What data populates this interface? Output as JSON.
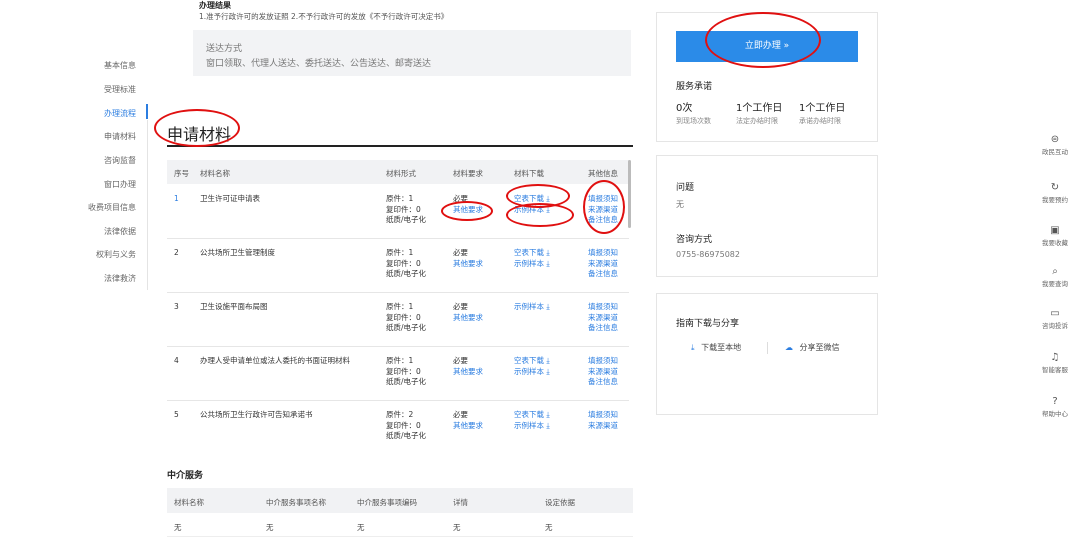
{
  "result": {
    "title": "办理结果",
    "text": "1.准予行政许可的发放证照 2.不予行政许可的发放《不予行政许可决定书》"
  },
  "delivery": {
    "title": "送达方式",
    "text": "窗口领取、代理人送达、委托送达、公告送达、邮寄送达"
  },
  "sidebar": {
    "items": [
      {
        "label": "基本信息"
      },
      {
        "label": "受理标准"
      },
      {
        "label": "办理流程"
      },
      {
        "label": "申请材料"
      },
      {
        "label": "咨询监督"
      },
      {
        "label": "窗口办理"
      },
      {
        "label": "收费项目信息"
      },
      {
        "label": "法律依据"
      },
      {
        "label": "权利与义务"
      },
      {
        "label": "法律救济"
      }
    ],
    "active_index": 2
  },
  "materials": {
    "section_title": "申请材料",
    "headers": [
      "序号",
      "材料名称",
      "材料形式",
      "材料要求",
      "材料下载",
      "其他信息"
    ],
    "rows": [
      {
        "no": "1",
        "name": "卫生许可证申请表",
        "forms": [
          "原件：1",
          "复印件：0",
          "纸质/电子化"
        ],
        "req": [
          "必要",
          "其他要求"
        ],
        "dl": [
          "空表下载",
          "示例样本"
        ],
        "other": [
          "填报须知",
          "来源渠道",
          "备注信息"
        ]
      },
      {
        "no": "2",
        "name": "公共场所卫生管理制度",
        "forms": [
          "原件：1",
          "复印件：0",
          "纸质/电子化"
        ],
        "req": [
          "必要",
          "其他要求"
        ],
        "dl": [
          "空表下载",
          "示例样本"
        ],
        "other": [
          "填报须知",
          "来源渠道",
          "备注信息"
        ]
      },
      {
        "no": "3",
        "name": "卫生设施平面布局图",
        "forms": [
          "原件：1",
          "复印件：0",
          "纸质/电子化"
        ],
        "req": [
          "必要",
          "其他要求"
        ],
        "dl": [
          "示例样本"
        ],
        "other": [
          "填报须知",
          "来源渠道",
          "备注信息"
        ]
      },
      {
        "no": "4",
        "name": "办理人受申请单位或法人委托的书面证明材料",
        "forms": [
          "原件：1",
          "复印件：0",
          "纸质/电子化"
        ],
        "req": [
          "必要",
          "其他要求"
        ],
        "dl": [
          "空表下载",
          "示例样本"
        ],
        "other": [
          "填报须知",
          "来源渠道",
          "备注信息"
        ]
      },
      {
        "no": "5",
        "name": "公共场所卫生行政许可告知承诺书",
        "forms": [
          "原件：2",
          "复印件：0",
          "纸质/电子化"
        ],
        "req": [
          "必要",
          "其他要求"
        ],
        "dl": [
          "空表下载",
          "示例样本"
        ],
        "other": [
          "填报须知",
          "来源渠道"
        ]
      }
    ]
  },
  "intermediary": {
    "title": "中介服务",
    "headers": [
      "材料名称",
      "中介服务事项名称",
      "中介服务事项编码",
      "详情",
      "设定依据"
    ],
    "row": [
      "无",
      "无",
      "无",
      "无",
      "无"
    ]
  },
  "service": {
    "apply_label": "立即办理 »",
    "commitment_title": "服务承诺",
    "stats": [
      {
        "value": "0次",
        "label": "到现场次数"
      },
      {
        "value": "1个工作日",
        "label": "法定办结时限"
      },
      {
        "value": "1个工作日",
        "label": "承诺办结时限"
      }
    ]
  },
  "question": {
    "title": "问题",
    "text": "无"
  },
  "consult": {
    "title": "咨询方式",
    "phone": "0755-86975082"
  },
  "guide": {
    "title": "指南下载与分享",
    "download": "下载至本地",
    "share": "分享至微信"
  },
  "float_menu": [
    {
      "icon": "chat-icon",
      "glyph": "⊜",
      "label": "政民互动"
    },
    {
      "icon": "appointment-icon",
      "glyph": "↻",
      "label": "我要预约"
    },
    {
      "icon": "favorite-icon",
      "glyph": "▣",
      "label": "我要收藏"
    },
    {
      "icon": "search-icon",
      "glyph": "⌕",
      "label": "我要查询"
    },
    {
      "icon": "complaint-icon",
      "glyph": "▭",
      "label": "咨询投诉"
    },
    {
      "icon": "headset-icon",
      "glyph": "♫",
      "label": "智能客服"
    },
    {
      "icon": "help-icon",
      "glyph": "?",
      "label": "帮助中心"
    }
  ],
  "colors": {
    "accent": "#2b8be8",
    "link": "#2b7de0",
    "annotation": "#e01010"
  }
}
